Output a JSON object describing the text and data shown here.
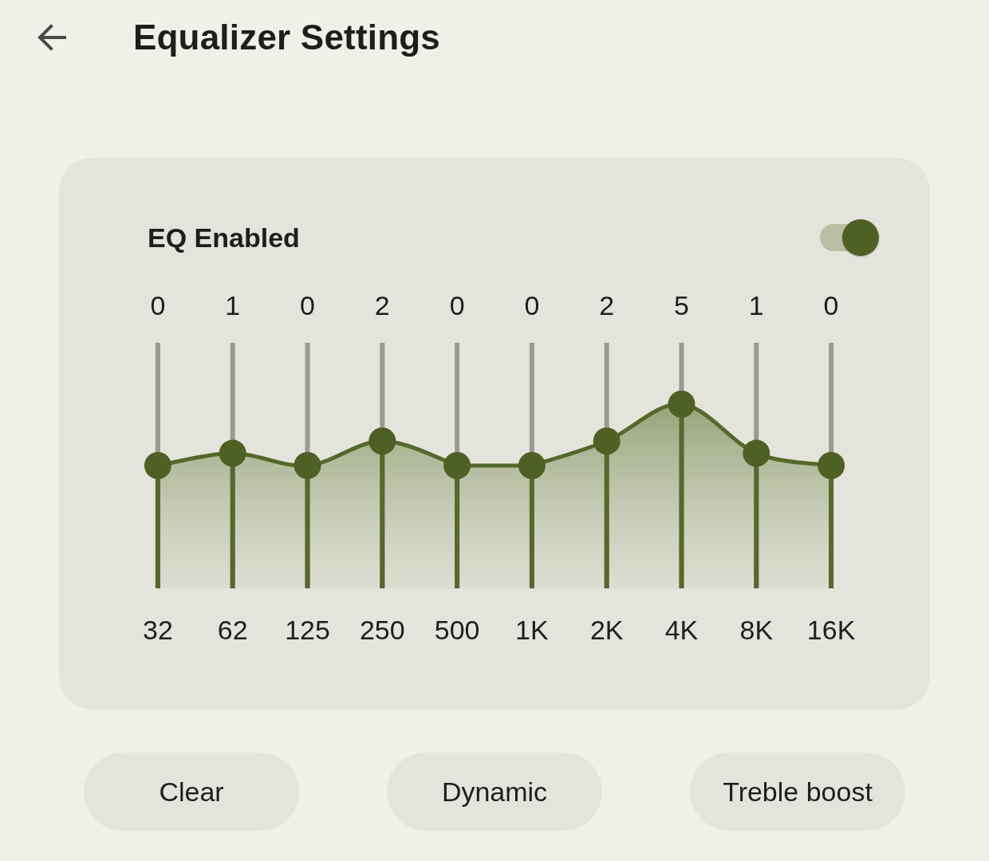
{
  "header": {
    "title": "Equalizer Settings"
  },
  "eq": {
    "label": "EQ Enabled",
    "enabled": true
  },
  "bands": [
    {
      "value": "0",
      "frequency": "32",
      "level": 0.5
    },
    {
      "value": "1",
      "frequency": "62",
      "level": 0.55
    },
    {
      "value": "0",
      "frequency": "125",
      "level": 0.5
    },
    {
      "value": "2",
      "frequency": "250",
      "level": 0.6
    },
    {
      "value": "0",
      "frequency": "500",
      "level": 0.5
    },
    {
      "value": "0",
      "frequency": "1K",
      "level": 0.5
    },
    {
      "value": "2",
      "frequency": "2K",
      "level": 0.6
    },
    {
      "value": "5",
      "frequency": "4K",
      "level": 0.75
    },
    {
      "value": "1",
      "frequency": "8K",
      "level": 0.55
    },
    {
      "value": "0",
      "frequency": "16K",
      "level": 0.5
    }
  ],
  "presets": [
    {
      "label": "Clear"
    },
    {
      "label": "Dynamic"
    },
    {
      "label": "Treble boost"
    }
  ]
}
